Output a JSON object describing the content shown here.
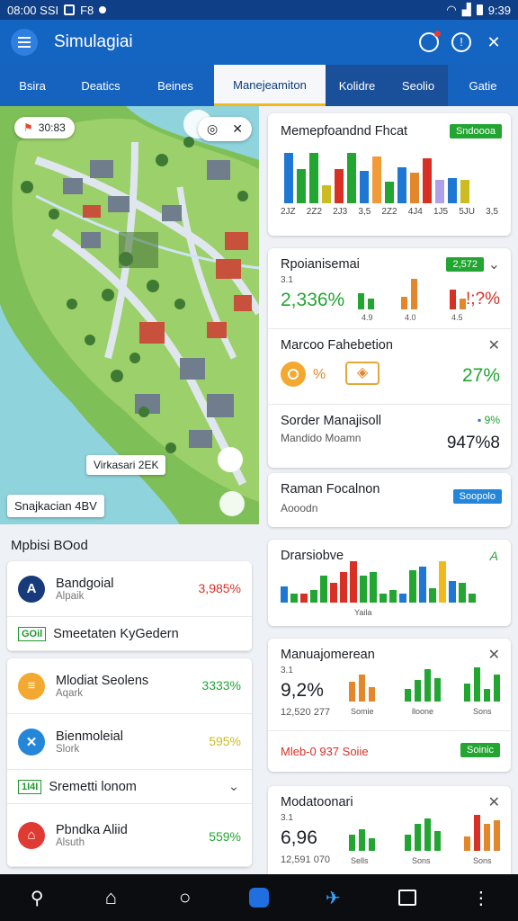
{
  "status": {
    "time_left": "08:00 SSI",
    "icon_left": "F8",
    "time_right": "9:39"
  },
  "app": {
    "title": "Simulagiai"
  },
  "tabs": [
    "Bsira",
    "Deatics",
    "Beines",
    "Manejeamiton",
    "Kolidre",
    "Seolio",
    "Gatie"
  ],
  "map": {
    "chip_top": "30:83",
    "chip_mid": "Virkasari  2EK",
    "chip_bottom": "Snajkacian 4BV"
  },
  "left_header": "Mpbisi BOod",
  "left_items": [
    {
      "name": "Bandgoial",
      "sub": "Alpaik",
      "value": "3,985%",
      "color": "#d93025",
      "icon_color": "#163a7a",
      "icon": "A"
    },
    {
      "name": "Mlodiat Seolens",
      "sub": "Aqark",
      "value": "3333%",
      "color": "#23a532",
      "icon_color": "#f3a830",
      "icon": "≡"
    },
    {
      "name": "Bienmoleial",
      "sub": "Slork",
      "value": "595%",
      "color": "#cdbb23",
      "icon_color": "#2386d8",
      "icon": "✕"
    },
    {
      "name": "Pbndka Aliid",
      "sub": "Alsuth",
      "value": "559%",
      "color": "#23a532",
      "icon_color": "#e03b33",
      "icon": "⌂"
    }
  ],
  "left_strips": [
    {
      "badge": "GOil",
      "label": "Smeetaten KyGedern"
    },
    {
      "badge": "1I4I",
      "label": "Sremetti lonom"
    }
  ],
  "cards": {
    "c1": {
      "title": "Memepfoandnd Fhcat",
      "badge": "Sndoooa",
      "labels": [
        "2JZ",
        "2Z2",
        "2J3",
        "3,5",
        "2Z2",
        "4J4",
        "1J5",
        "5JU",
        "3,5"
      ],
      "bars": [
        [
          56,
          "#1f77d4"
        ],
        [
          38,
          "#23a532"
        ],
        [
          56,
          "#23a532"
        ],
        [
          20,
          "#cdbb23"
        ],
        [
          38,
          "#d93025"
        ],
        [
          56,
          "#23a532"
        ],
        [
          36,
          "#1f77d4"
        ],
        [
          52,
          "#f29a38"
        ],
        [
          24,
          "#23a532"
        ],
        [
          40,
          "#1f77d4"
        ],
        [
          34,
          "#e4862a"
        ],
        [
          50,
          "#d93025"
        ],
        [
          26,
          "#b0a0e8"
        ],
        [
          28,
          "#1f77d4"
        ],
        [
          26,
          "#cdbb23"
        ]
      ]
    },
    "c2": {
      "title": "Rpoianisemai",
      "badge": "2,572",
      "pct": "2,336%",
      "pct_red": "!;?%",
      "small": [
        "3.1",
        "4.9",
        "4.0",
        "4.5"
      ],
      "bars1": [
        [
          18,
          "#23a532"
        ],
        [
          12,
          "#23a532"
        ]
      ],
      "bars2": [
        [
          14,
          "#e4862a"
        ],
        [
          34,
          "#e4862a"
        ]
      ],
      "bars3": [
        [
          22,
          "#d93025"
        ],
        [
          12,
          "#e4862a"
        ]
      ]
    },
    "c3": {
      "title": "Marcoo Fahebetion",
      "pct": "27%",
      "tag": "%"
    },
    "c4": {
      "title": "Sorder Manajisoll",
      "sub": "Mandido Moamn",
      "tag": "9%",
      "value": "947%8"
    },
    "c5": {
      "title": "Raman Focalnon",
      "sub": "Aooodn",
      "badge": "Soopolo"
    },
    "c6": {
      "title": "Drarsiobve",
      "label": "Yaila",
      "tag": "A",
      "bars": [
        [
          18,
          "#1f77d4"
        ],
        [
          10,
          "#23a532"
        ],
        [
          10,
          "#d93025"
        ],
        [
          14,
          "#23a532"
        ],
        [
          30,
          "#23a532"
        ],
        [
          22,
          "#d93025"
        ],
        [
          34,
          "#d93025"
        ],
        [
          46,
          "#d93025"
        ],
        [
          30,
          "#23a532"
        ],
        [
          34,
          "#23a532"
        ],
        [
          10,
          "#23a532"
        ],
        [
          14,
          "#23a532"
        ],
        [
          10,
          "#1f77d4"
        ],
        [
          36,
          "#23a532"
        ],
        [
          40,
          "#1f77d4"
        ],
        [
          16,
          "#23a532"
        ],
        [
          46,
          "#f2b91e"
        ],
        [
          24,
          "#1f77d4"
        ],
        [
          22,
          "#23a532"
        ],
        [
          10,
          "#23a532"
        ]
      ]
    },
    "c7": {
      "title": "Manuajomerean",
      "pct": "9,2%",
      "small": "3.1",
      "bottom": "12,520 277",
      "l1": "Somie",
      "l2": "lloone",
      "l3": "Sons",
      "foot": "Mleb-0 937 Soiie",
      "badge": "Soinic"
    },
    "c8": {
      "title": "Modatoonari",
      "pct": "6,96",
      "small": "3.1",
      "bottom": "12,591 070",
      "l1": "Sells",
      "l2": "Sons",
      "l3": "Sons"
    }
  }
}
